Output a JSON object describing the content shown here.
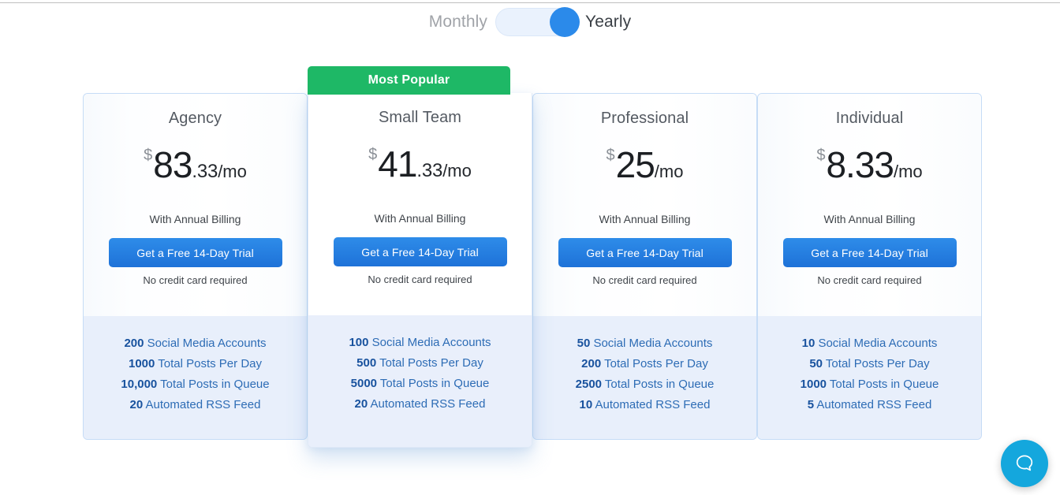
{
  "billing_toggle": {
    "monthly_label": "Monthly",
    "yearly_label": "Yearly",
    "selected": "Yearly",
    "track_color": "#eaf2fd",
    "knob_color": "#2b8aea"
  },
  "badge": {
    "label": "Most Popular",
    "color": "#1eb866"
  },
  "plans": [
    {
      "name": "Agency",
      "currency": "$",
      "amount": "83",
      "cents": ".33",
      "per": "/mo",
      "billing_note": "With Annual Billing",
      "cta_label": "Get a Free 14-Day Trial",
      "fineprint": "No credit card required",
      "featured": false,
      "features": [
        {
          "value": "200",
          "label": " Social Media Accounts"
        },
        {
          "value": "1000",
          "label": " Total Posts Per Day"
        },
        {
          "value": "10,000",
          "label": " Total Posts in Queue"
        },
        {
          "value": "20",
          "label": " Automated RSS Feed"
        }
      ]
    },
    {
      "name": "Small Team",
      "currency": "$",
      "amount": "41",
      "cents": ".33",
      "per": "/mo",
      "billing_note": "With Annual Billing",
      "cta_label": "Get a Free 14-Day Trial",
      "fineprint": "No credit card required",
      "featured": true,
      "features": [
        {
          "value": "100",
          "label": " Social Media Accounts"
        },
        {
          "value": "500",
          "label": " Total Posts Per Day"
        },
        {
          "value": "5000",
          "label": " Total Posts in Queue"
        },
        {
          "value": "20",
          "label": " Automated RSS Feed"
        }
      ]
    },
    {
      "name": "Professional",
      "currency": "$",
      "amount": "25",
      "cents": "",
      "per": "/mo",
      "billing_note": "With Annual Billing",
      "cta_label": "Get a Free 14-Day Trial",
      "fineprint": "No credit card required",
      "featured": false,
      "features": [
        {
          "value": "50",
          "label": " Social Media Accounts"
        },
        {
          "value": "200",
          "label": " Total Posts Per Day"
        },
        {
          "value": "2500",
          "label": " Total Posts in Queue"
        },
        {
          "value": "10",
          "label": " Automated RSS Feed"
        }
      ]
    },
    {
      "name": "Individual",
      "currency": "$",
      "amount": "8.33",
      "cents": "",
      "per": "/mo",
      "billing_note": "With Annual Billing",
      "cta_label": "Get a Free 14-Day Trial",
      "fineprint": "No credit card required",
      "featured": false,
      "features": [
        {
          "value": "10",
          "label": " Social Media Accounts"
        },
        {
          "value": "50",
          "label": " Total Posts Per Day"
        },
        {
          "value": "1000",
          "label": " Total Posts in Queue"
        },
        {
          "value": "5",
          "label": " Automated RSS Feed"
        }
      ]
    }
  ],
  "beacon": {
    "icon": "chat-bubble-icon",
    "color": "#14a7dd"
  }
}
